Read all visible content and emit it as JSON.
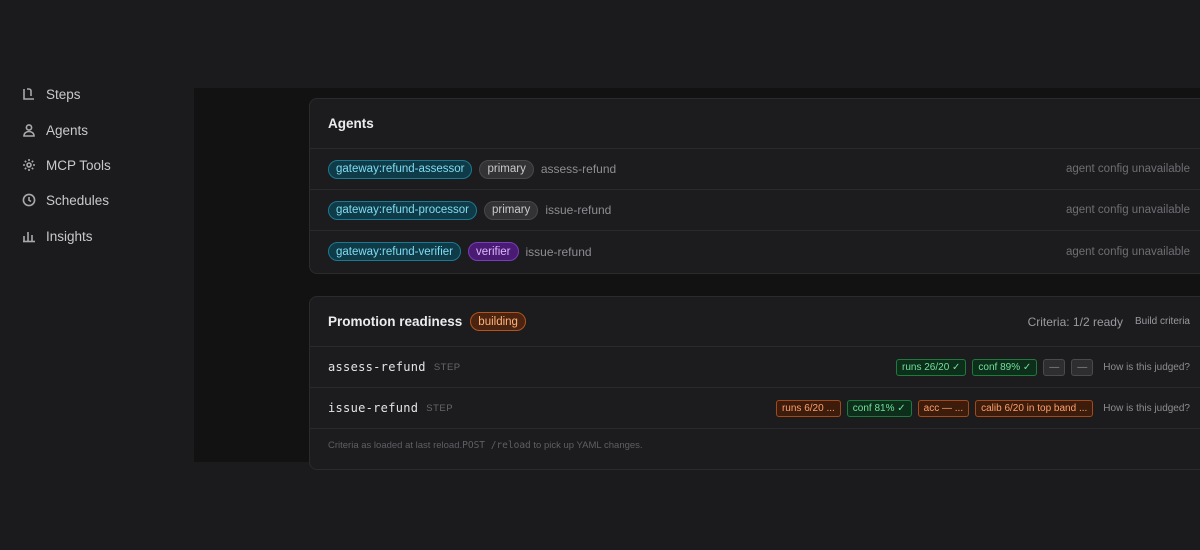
{
  "sidebar": {
    "items": [
      {
        "label": "Steps",
        "icon": "steps-icon"
      },
      {
        "label": "Agents",
        "icon": "agents-icon"
      },
      {
        "label": "MCP Tools",
        "icon": "gear-icon"
      },
      {
        "label": "Schedules",
        "icon": "clock-icon"
      },
      {
        "label": "Insights",
        "icon": "bar-chart-icon"
      }
    ]
  },
  "agents": {
    "title": "Agents",
    "rows": [
      {
        "agent": "gateway:refund-assessor",
        "role": "primary",
        "step": "assess-refund",
        "status": "agent config unavailable"
      },
      {
        "agent": "gateway:refund-processor",
        "role": "primary",
        "step": "issue-refund",
        "status": "agent config unavailable"
      },
      {
        "agent": "gateway:refund-verifier",
        "role": "verifier",
        "step": "issue-refund",
        "status": "agent config unavailable"
      }
    ]
  },
  "promotion": {
    "title": "Promotion readiness",
    "badge": "building",
    "criteria": "Criteria: 1/2 ready",
    "build_label": "Build criteria",
    "rows": [
      {
        "step": "assess-refund",
        "tag": "STEP",
        "chips": [
          {
            "text": "runs 26/20 ✓",
            "tone": "green"
          },
          {
            "text": "conf 89% ✓",
            "tone": "green"
          },
          {
            "text": "—",
            "tone": "gray"
          },
          {
            "text": "—",
            "tone": "gray"
          }
        ],
        "judge": "How is this judged?"
      },
      {
        "step": "issue-refund",
        "tag": "STEP",
        "chips": [
          {
            "text": "runs 6/20 ...",
            "tone": "orange"
          },
          {
            "text": "conf 81% ✓",
            "tone": "green"
          },
          {
            "text": "acc — ...",
            "tone": "orange"
          },
          {
            "text": "calib 6/20 in top band ...",
            "tone": "orange"
          }
        ],
        "judge": "How is this judged?"
      }
    ],
    "footnote": {
      "pre": "Criteria as loaded at last reload. ",
      "code": "POST /reload",
      "post": " to pick up YAML changes."
    }
  }
}
